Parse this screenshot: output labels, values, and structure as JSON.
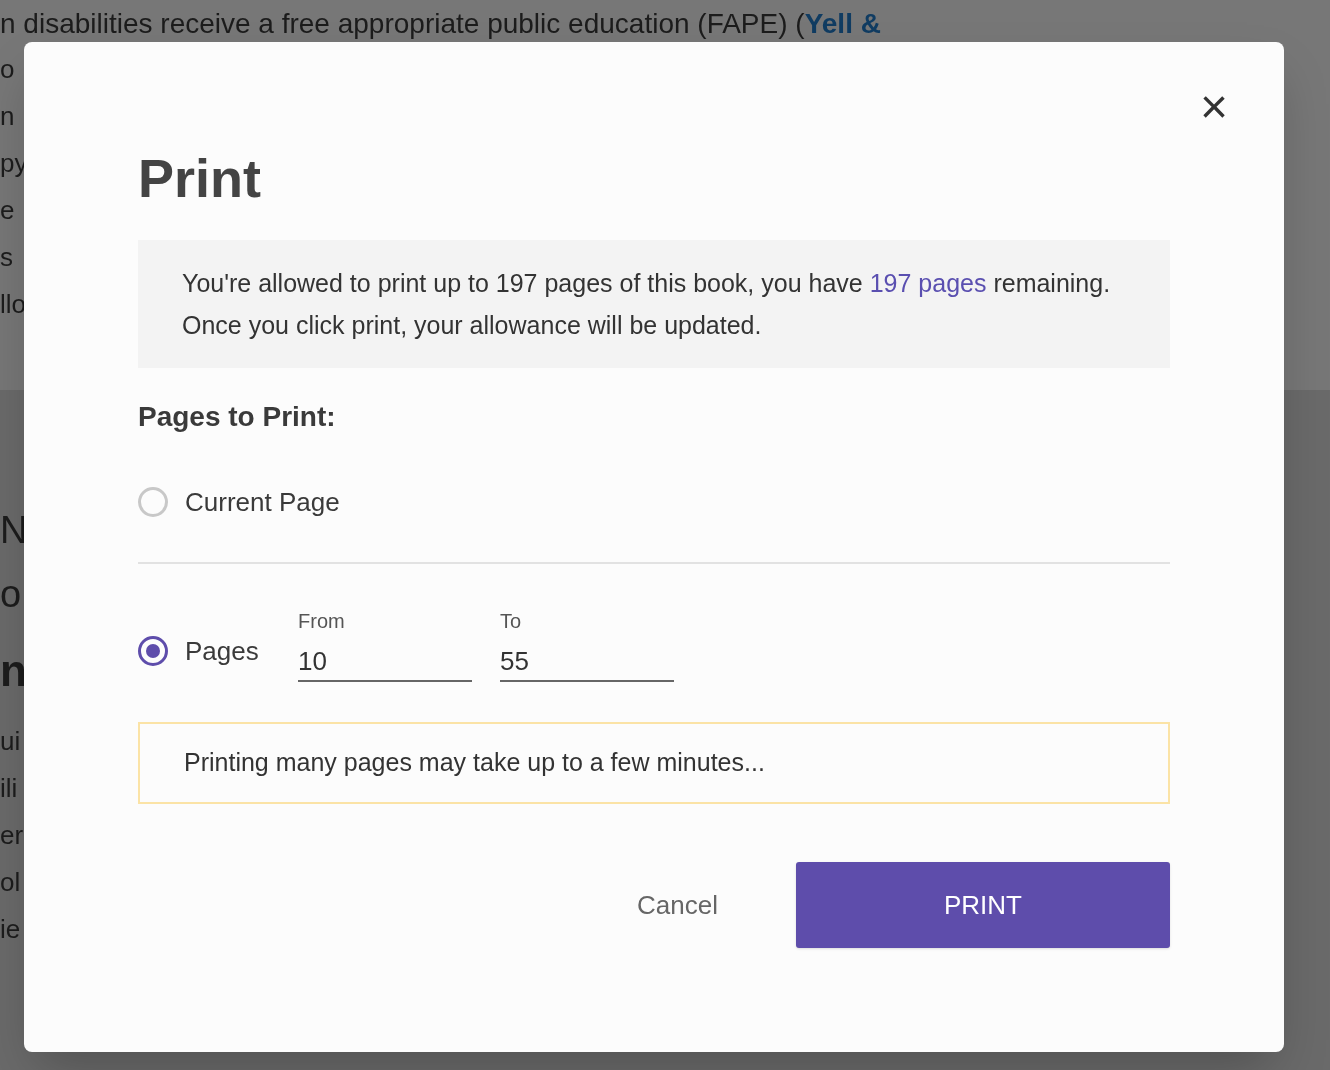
{
  "background": {
    "lead": {
      "text": "n disabilities receive a free appropriate public education (FAPE) (",
      "link": "Yell &"
    },
    "lines": [
      {
        "kind": "body",
        "text": "o"
      },
      {
        "kind": "body",
        "text": "n"
      },
      {
        "kind": "body",
        "text": "py"
      },
      {
        "kind": "body",
        "text": "e"
      },
      {
        "kind": "body",
        "text": "s"
      },
      {
        "kind": "body",
        "text": "llo"
      },
      {
        "kind": "subhead",
        "text": "N"
      },
      {
        "kind": "subhead",
        "text": "o"
      },
      {
        "kind": "heading",
        "text": "n"
      },
      {
        "kind": "body",
        "text": "ui"
      },
      {
        "kind": "body",
        "text": "ili"
      },
      {
        "kind": "body",
        "text": "er"
      },
      {
        "kind": "body",
        "text": "ol"
      },
      {
        "kind": "body",
        "text": "ie"
      }
    ]
  },
  "dialog": {
    "title": "Print",
    "close": "×",
    "notice": {
      "before": "You're allowed to print up to 197 pages of this book, you have ",
      "link": "197 pages",
      "after": " remaining. Once you click print, your allowance will be updated."
    },
    "section_label": "Pages to Print:",
    "options": [
      {
        "kind": "single",
        "label": "Current Page",
        "selected": false
      },
      {
        "kind": "range",
        "label": "Pages",
        "selected": true,
        "fields": [
          {
            "label": "From",
            "value": "10"
          },
          {
            "label": "To",
            "value": "55"
          }
        ]
      }
    ],
    "warning": "Printing many pages may take up to a few minutes...",
    "buttons": [
      {
        "kind": "text",
        "label": "Cancel"
      },
      {
        "kind": "primary",
        "label": "PRINT"
      }
    ]
  }
}
